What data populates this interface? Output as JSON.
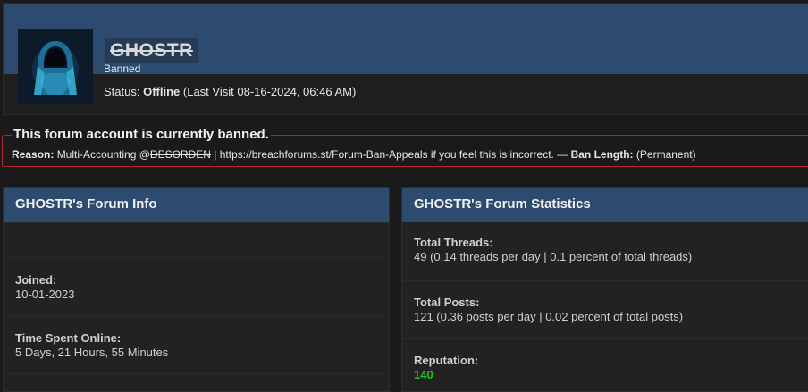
{
  "profile": {
    "username": "GHOSTR",
    "user_title": "Banned",
    "status_label": "Status:",
    "status_value": "Offline",
    "last_visit": "(Last Visit 08-16-2024, 06:46 AM)",
    "banner_color": "#2c4b6e"
  },
  "ban": {
    "heading": "This forum account is currently banned.",
    "reason_label": "Reason:",
    "reason_prefix": "Multi-Accounting @",
    "reason_struck": "DESORDEN",
    "reason_suffix": "| https://breachforums.st/Forum-Ban-Appeals if you feel this is incorrect. —",
    "length_label": "Ban Length:",
    "length_value": "(Permanent)",
    "border_color": "#b3262b"
  },
  "forum_info": {
    "title": "GHOSTR's Forum Info",
    "rows": [
      {
        "label": "Joined:",
        "value": "10-01-2023"
      },
      {
        "label": "Time Spent Online:",
        "value": "5 Days, 21 Hours, 55 Minutes"
      }
    ]
  },
  "forum_stats": {
    "title": "GHOSTR's Forum Statistics",
    "rows": [
      {
        "label": "Total Threads:",
        "value": "49 (0.14 threads per day | 0.1 percent of total threads)"
      },
      {
        "label": "Total Posts:",
        "value": "121 (0.36 posts per day | 0.02 percent of total posts)"
      },
      {
        "label": "Reputation:",
        "value": "140"
      }
    ],
    "reputation_color": "#1fbf1f"
  }
}
